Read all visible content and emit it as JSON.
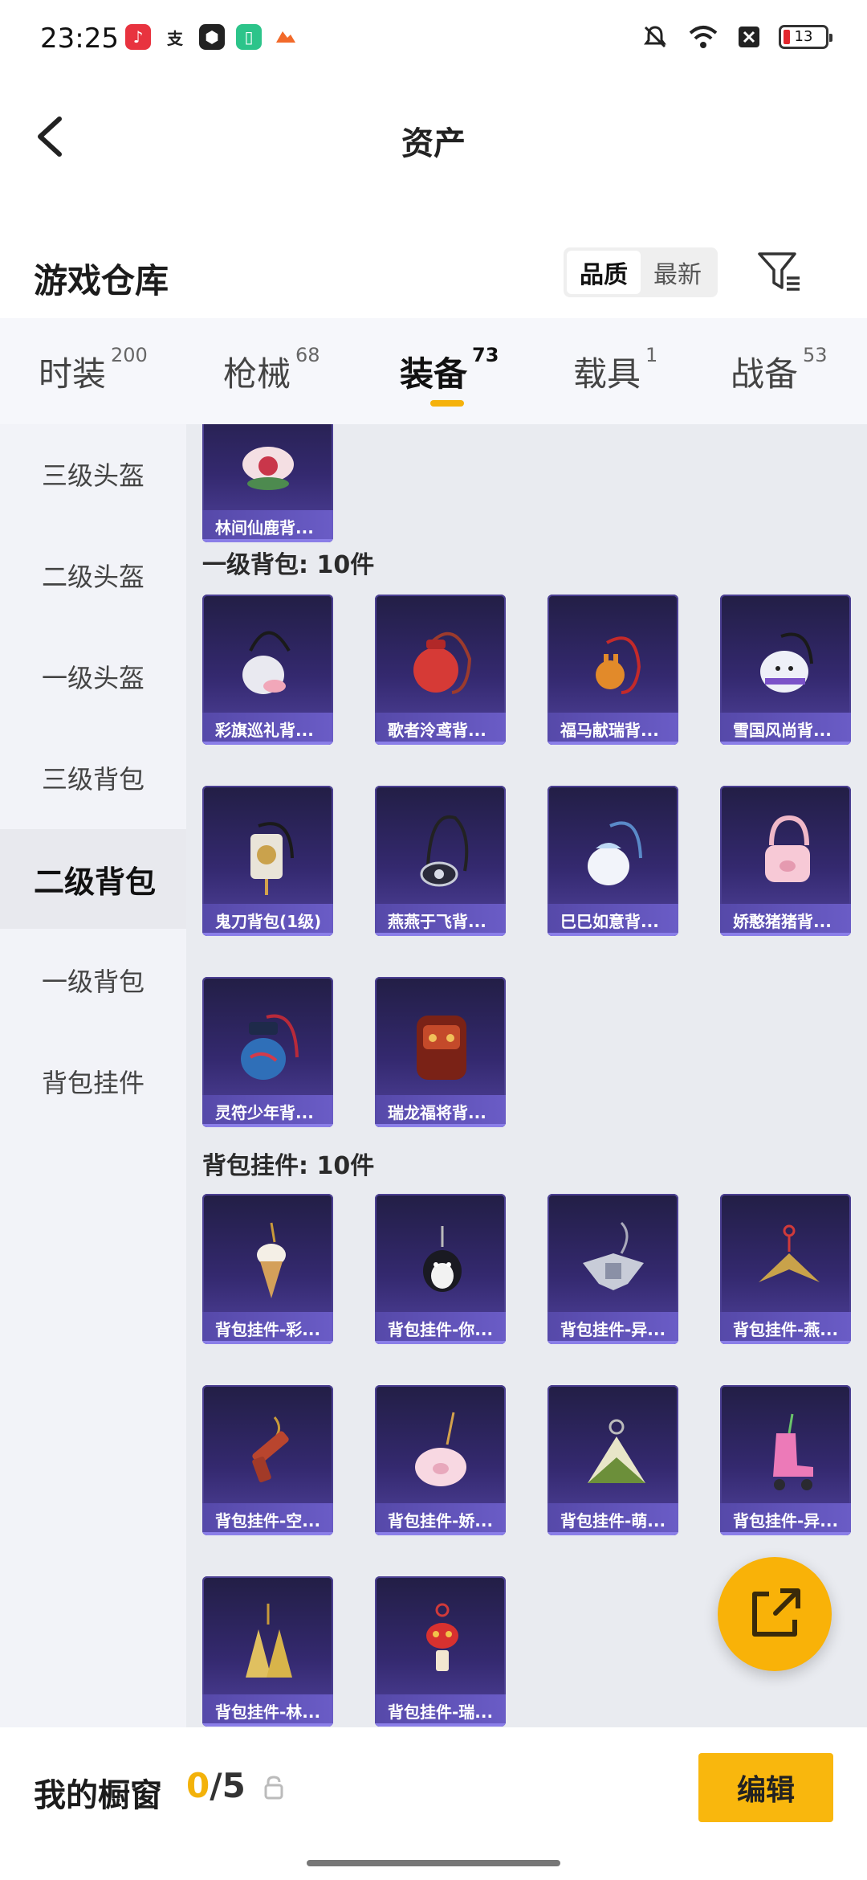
{
  "status_bar": {
    "time": "23:25",
    "battery": "13"
  },
  "header": {
    "title": "资产"
  },
  "warehouse": {
    "title": "游戏仓库",
    "sort_options": [
      "品质",
      "最新"
    ],
    "sort_active": "品质"
  },
  "tabs": [
    {
      "label": "时装",
      "count": "200"
    },
    {
      "label": "枪械",
      "count": "68"
    },
    {
      "label": "装备",
      "count": "73",
      "active": true
    },
    {
      "label": "载具",
      "count": "1"
    },
    {
      "label": "战备",
      "count": "53"
    }
  ],
  "sidebar": {
    "items": [
      "三级头盔",
      "二级头盔",
      "一级头盔",
      "三级背包",
      "二级背包",
      "一级背包",
      "背包挂件"
    ],
    "active": "二级背包"
  },
  "content": {
    "top_partial_item": "林间仙鹿背...",
    "sections": [
      {
        "title": "一级背包: 10件",
        "items": [
          "彩旗巡礼背...",
          "歌者泠鸢背...",
          "福马献瑞背...",
          "雪国风尚背...",
          "鬼刀背包(1级)",
          "燕燕于飞背...",
          "巳巳如意背...",
          "娇憨猪猪背...",
          "灵符少年背...",
          "瑞龙福将背..."
        ]
      },
      {
        "title": "背包挂件: 10件",
        "items": [
          "背包挂件-彩...",
          "背包挂件-你...",
          "背包挂件-异...",
          "背包挂件-燕...",
          "背包挂件-空...",
          "背包挂件-娇...",
          "背包挂件-萌...",
          "背包挂件-异...",
          "背包挂件-林...",
          "背包挂件-瑞..."
        ]
      }
    ]
  },
  "bottom_bar": {
    "title": "我的橱窗",
    "count_current": "0",
    "count_total": "/5",
    "edit_label": "编辑"
  },
  "colors": {
    "accent": "#f9b70d",
    "card_bg": "#34296f",
    "card_label": "#6a5cc6"
  }
}
